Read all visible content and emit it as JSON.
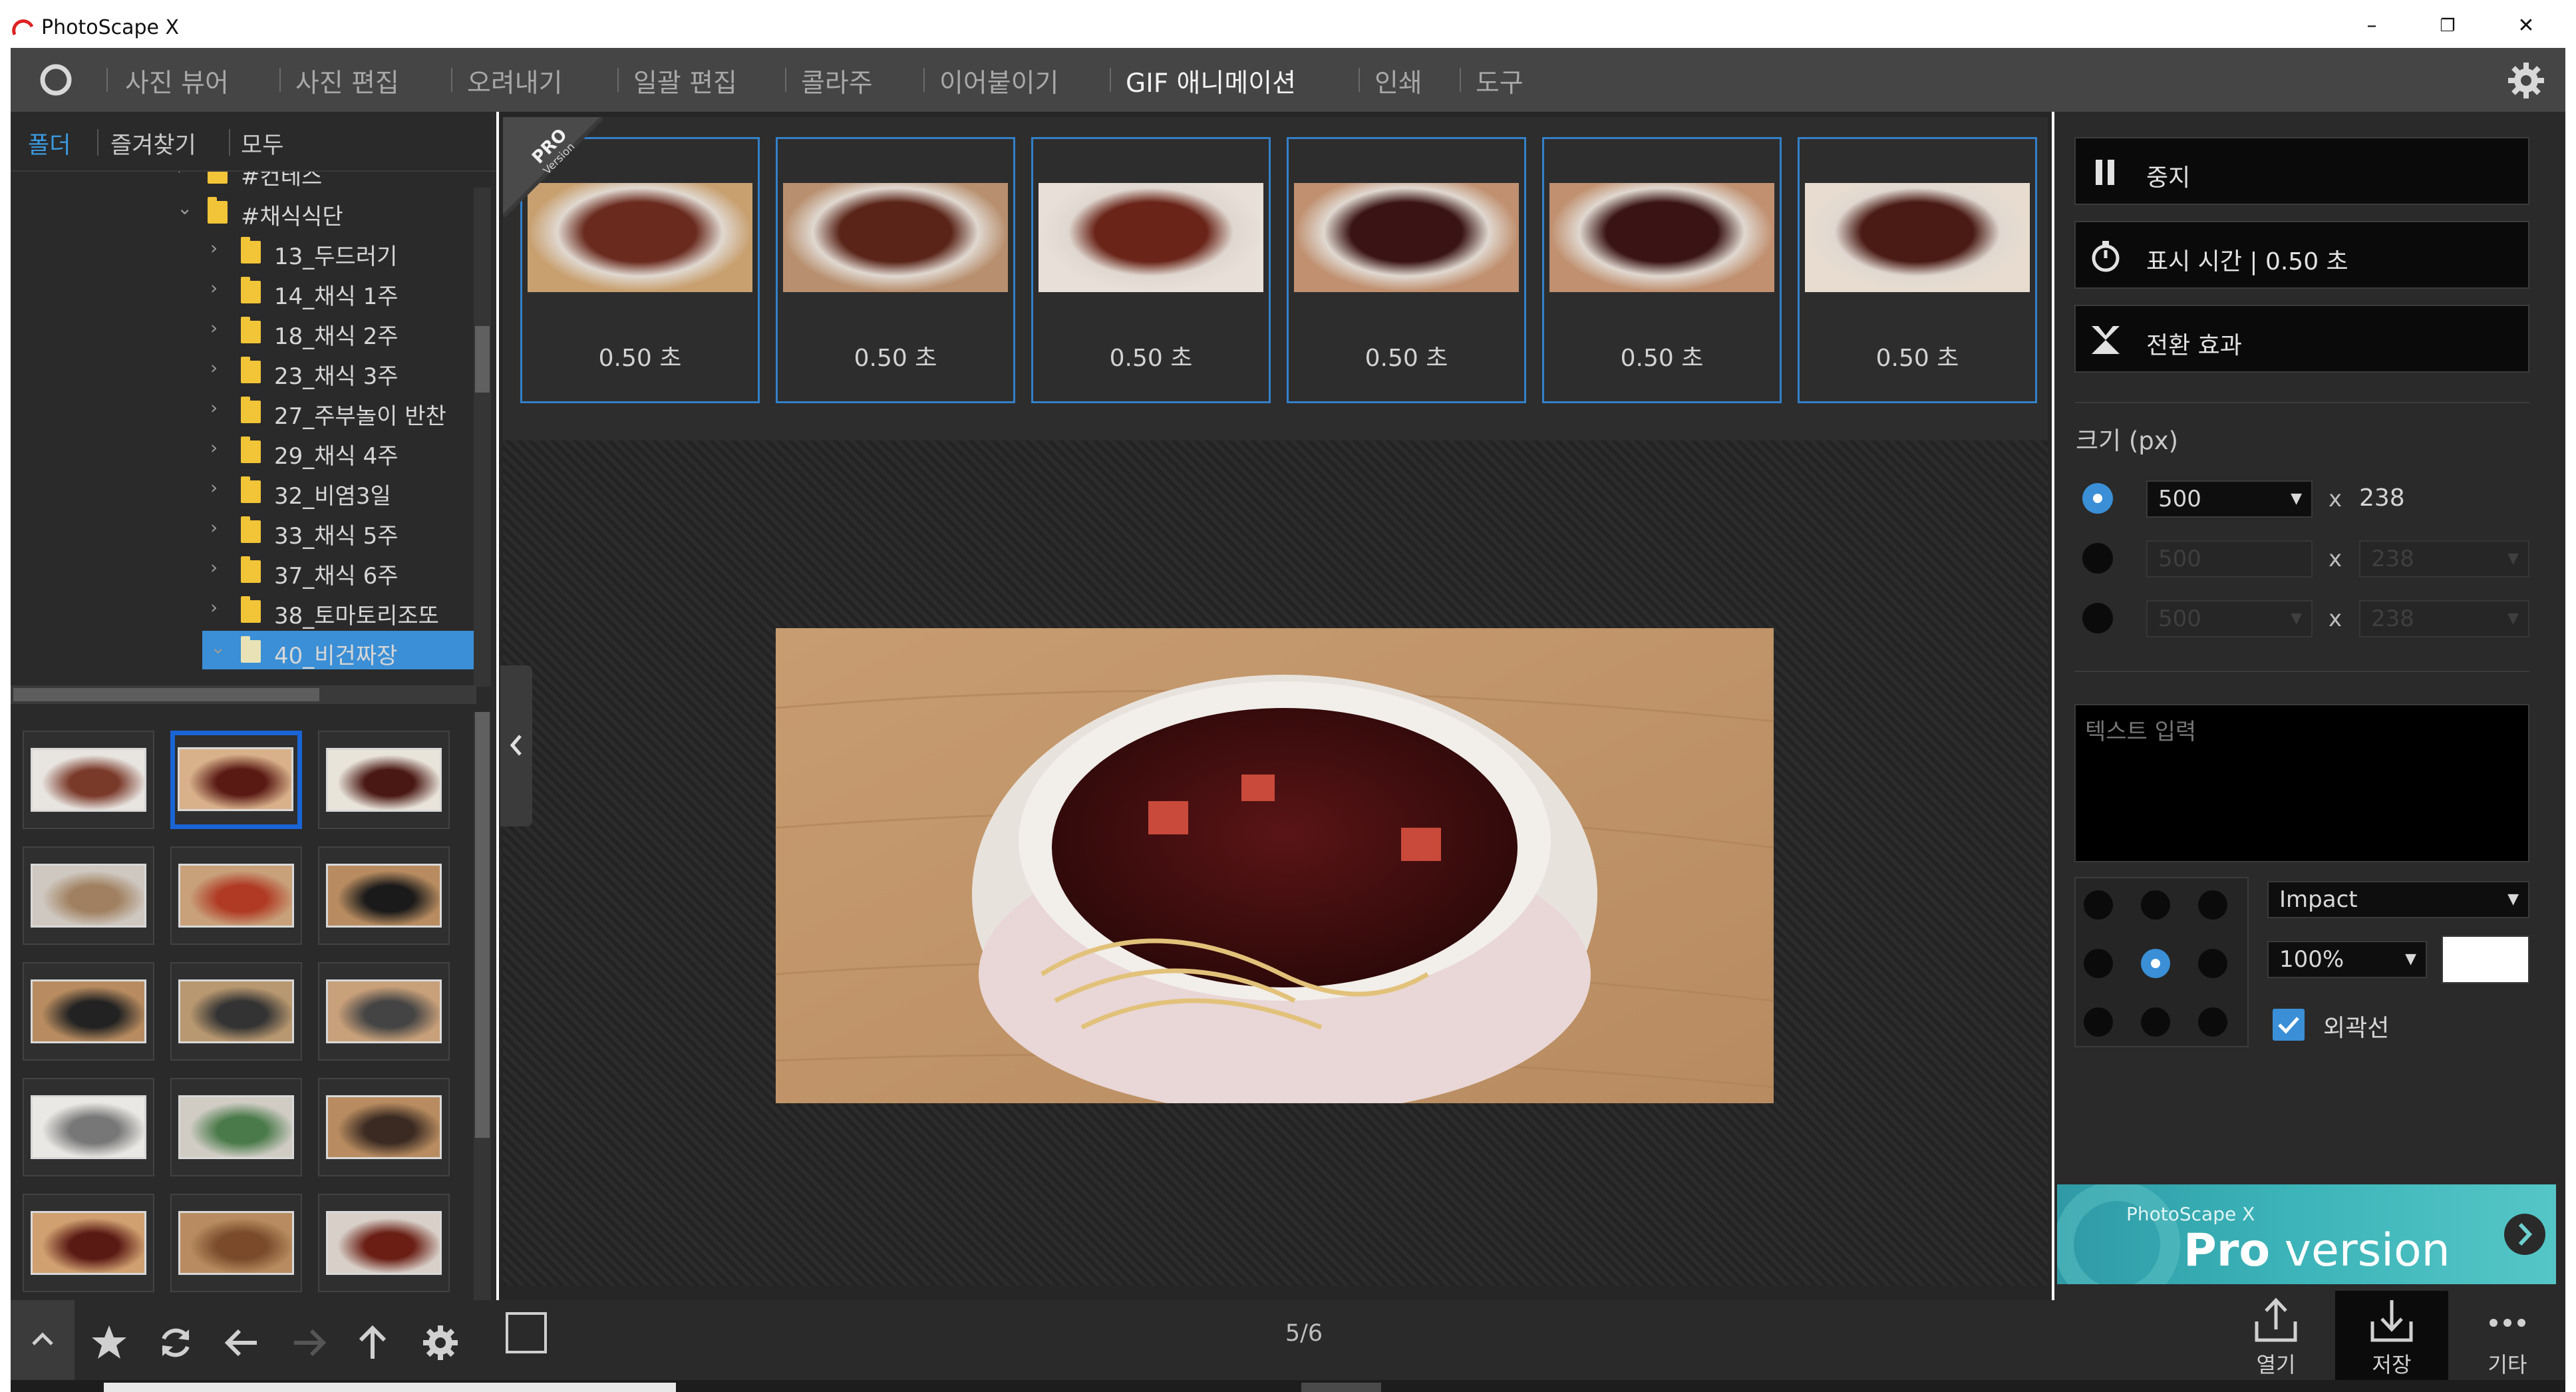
{
  "window": {
    "title": "PhotoScape X",
    "minimize": "–",
    "restore": "❐",
    "close": "✕"
  },
  "nav": {
    "items": [
      "사진 뷰어",
      "사진 편집",
      "오려내기",
      "일괄 편집",
      "콜라주",
      "이어붙이기",
      "GIF 애니메이션",
      "인쇄",
      "도구"
    ],
    "active_index": 6
  },
  "left_tabs": [
    "폴더",
    "즐겨찾기",
    "모두"
  ],
  "tree": [
    {
      "label": "#컨테스",
      "indent": 1,
      "chevron": "›"
    },
    {
      "label": "#채식식단",
      "indent": 1,
      "chevron": "⌄"
    },
    {
      "label": "13_두드러기",
      "indent": 2,
      "chevron": "›"
    },
    {
      "label": "14_채식 1주",
      "indent": 2,
      "chevron": "›"
    },
    {
      "label": "18_채식 2주",
      "indent": 2,
      "chevron": "›"
    },
    {
      "label": "23_채식 3주",
      "indent": 2,
      "chevron": "›"
    },
    {
      "label": "27_주부놀이 반찬",
      "indent": 2,
      "chevron": "›"
    },
    {
      "label": "29_채식 4주",
      "indent": 2,
      "chevron": "›"
    },
    {
      "label": "32_비염3일",
      "indent": 2,
      "chevron": "›"
    },
    {
      "label": "33_채식 5주",
      "indent": 2,
      "chevron": "›"
    },
    {
      "label": "37_채식 6주",
      "indent": 2,
      "chevron": "›"
    },
    {
      "label": "38_토마토리조또",
      "indent": 2,
      "chevron": "›"
    },
    {
      "label": "40_비건짜장",
      "indent": 2,
      "chevron": "⌄",
      "selected": true
    }
  ],
  "frames": [
    {
      "duration": "0.50 초"
    },
    {
      "duration": "0.50 초"
    },
    {
      "duration": "0.50 초"
    },
    {
      "duration": "0.50 초"
    },
    {
      "duration": "0.50 초"
    },
    {
      "duration": "0.50 초"
    }
  ],
  "pro_badge": {
    "line1": "PRO",
    "line2": "Version"
  },
  "counter": "5/6",
  "right": {
    "pause_label": "중지",
    "display_time_label": "표시 시간 | 0.50 초",
    "transition_label": "전환 효과",
    "size_label": "크기 (px)",
    "size_rows": [
      {
        "width": "500",
        "x": "x",
        "height": "238",
        "selected": true
      },
      {
        "width": "500",
        "x": "x",
        "height": "238",
        "selected": false
      },
      {
        "width": "500",
        "x": "x",
        "height": "238",
        "selected": false
      }
    ],
    "text_placeholder": "텍스트 입력",
    "font": "Impact",
    "scale": "100%",
    "text_color": "#ffffff",
    "outline_label": "외곽선",
    "outline_checked": true
  },
  "pro_banner": {
    "small": "PhotoScape X",
    "big_bold": "Pro",
    "big_rest": " version"
  },
  "actions": [
    {
      "label": "열기",
      "icon": "upload-icon"
    },
    {
      "label": "저장",
      "icon": "download-icon",
      "active": true
    },
    {
      "label": "기타",
      "icon": "more-icon"
    }
  ],
  "colors": {
    "accent": "#3a8fd6",
    "frame_border": "#3380c8",
    "nav_bg": "#454545",
    "panel_bg": "#2a2a2a"
  }
}
